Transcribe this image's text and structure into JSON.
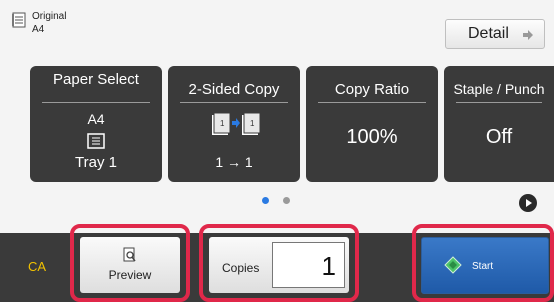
{
  "original": {
    "label": "Original",
    "size": "A4",
    "icon": "document-icon"
  },
  "detail_button": {
    "label": "Detail",
    "icon": "arrow-right-icon"
  },
  "cards": [
    {
      "title": "Paper Select",
      "value": "A4",
      "icon": "tray-icon",
      "sub": "Tray 1"
    },
    {
      "title": "2-Sided Copy",
      "icon": "duplex-icon",
      "sub": "1 → 1"
    },
    {
      "title": "Copy Ratio",
      "value": "100%"
    },
    {
      "title": "Staple / Punch",
      "value": "Off"
    }
  ],
  "pager": {
    "pages": 2,
    "current": 1,
    "active_color": "#2a7ae2",
    "inactive_color": "#9a9a9a",
    "next_icon": "play-icon"
  },
  "bottom": {
    "ca_label": "CA",
    "preview_label": "Preview",
    "preview_icon": "magnifier-icon",
    "copies_label": "Copies",
    "copies_value": "1",
    "start_label": "Start",
    "start_icon": "diamond-start-icon"
  },
  "colors": {
    "highlight": "#e0284a",
    "ca_text": "#f2c200",
    "start_bg": "#2a6bbd"
  }
}
